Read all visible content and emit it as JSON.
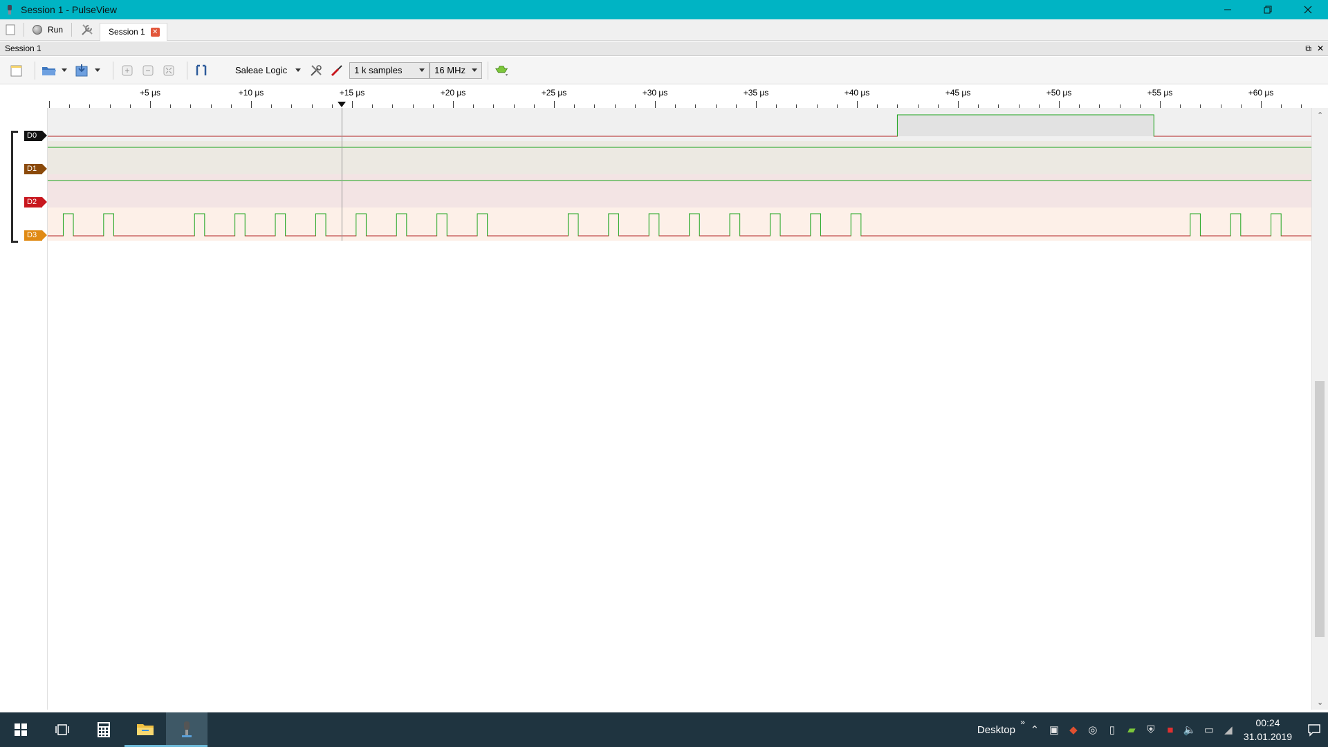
{
  "window": {
    "title": "Session 1 - PulseView"
  },
  "tabbar": {
    "run_label": "Run",
    "session_tab_label": "Session 1"
  },
  "session": {
    "header_label": "Session 1",
    "device_label": "Saleae Logic",
    "samples_value": "1 k samples",
    "samplerate_value": "16 MHz"
  },
  "ruler": {
    "labels": [
      "+5 μs",
      "+10 μs",
      "+15 μs",
      "+20 μs",
      "+25 μs",
      "+30 μs",
      "+35 μs",
      "+40 μs",
      "+45 μs",
      "+50 μs",
      "+55 μs",
      "+60 μs"
    ],
    "cursor_us": 14.5
  },
  "channels": [
    {
      "name": "D0",
      "color": "#111111",
      "bg": "#f0f0f0",
      "trace_color": "#b22222"
    },
    {
      "name": "D1",
      "color": "#8b4a0b",
      "bg": "#ece9e2",
      "trace_color": "#1aa31a"
    },
    {
      "name": "D2",
      "color": "#c8161d",
      "bg": "#f3e4e4",
      "trace_color": "#1aa31a"
    },
    {
      "name": "D3",
      "color": "#e08a14",
      "bg": "#fdf0e8",
      "trace_color": "#b22222"
    }
  ],
  "signals": {
    "D0_high_us": [
      [
        42.0,
        54.7
      ]
    ],
    "D3_pulses_us": [
      [
        0.7,
        1.2
      ],
      [
        2.7,
        3.2
      ],
      [
        7.2,
        7.7
      ],
      [
        9.2,
        9.7
      ],
      [
        11.2,
        11.7
      ],
      [
        13.2,
        13.7
      ],
      [
        15.2,
        15.7
      ],
      [
        17.2,
        17.7
      ],
      [
        19.2,
        19.7
      ],
      [
        21.2,
        21.7
      ],
      [
        25.7,
        26.2
      ],
      [
        27.7,
        28.2
      ],
      [
        29.7,
        30.2
      ],
      [
        31.7,
        32.2
      ],
      [
        33.7,
        34.2
      ],
      [
        35.7,
        36.2
      ],
      [
        37.7,
        38.2
      ],
      [
        39.7,
        40.2
      ],
      [
        56.5,
        57.0
      ],
      [
        58.5,
        59.0
      ],
      [
        60.5,
        61.0
      ]
    ]
  },
  "taskbar": {
    "desktop_label": "Desktop",
    "time": "00:24",
    "date": "31.01.2019"
  }
}
